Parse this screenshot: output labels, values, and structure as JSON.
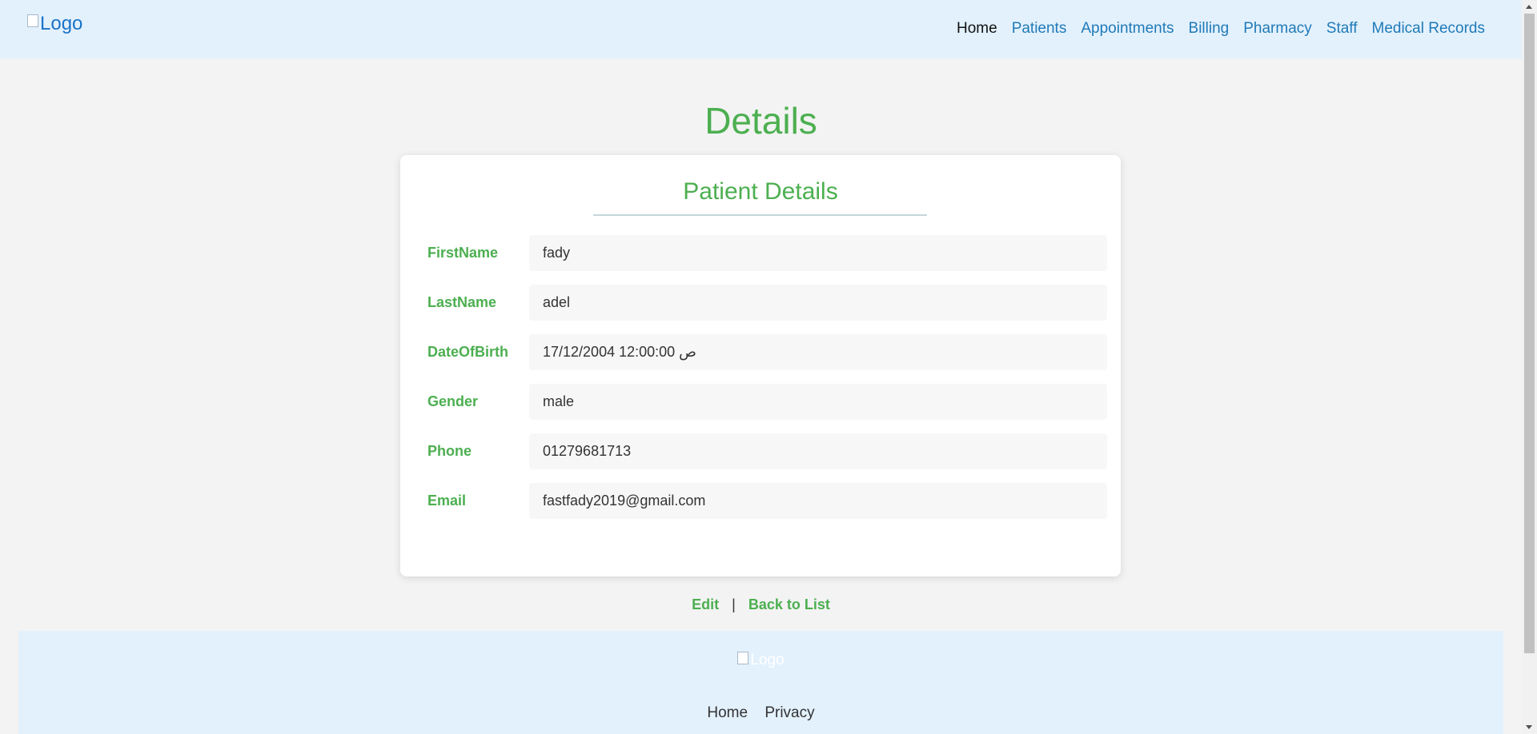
{
  "header": {
    "logo_alt": "Logo",
    "nav": {
      "home": "Home",
      "patients": "Patients",
      "appointments": "Appointments",
      "billing": "Billing",
      "pharmacy": "Pharmacy",
      "staff": "Staff",
      "medical_records": "Medical Records"
    },
    "active_nav": "Home"
  },
  "main": {
    "title": "Details",
    "card": {
      "title": "Patient Details",
      "fields": [
        {
          "label": "FirstName",
          "value": "fady"
        },
        {
          "label": "LastName",
          "value": "adel"
        },
        {
          "label": "DateOfBirth",
          "value": "17/12/2004 12:00:00 ص"
        },
        {
          "label": "Gender",
          "value": "male"
        },
        {
          "label": "Phone",
          "value": "01279681713"
        },
        {
          "label": "Email",
          "value": "fastfady2019@gmail.com"
        }
      ]
    },
    "actions": {
      "edit": "Edit",
      "separator": "|",
      "back": "Back to List"
    }
  },
  "footer": {
    "logo_alt": "Logo",
    "links": {
      "home": "Home",
      "privacy": "Privacy"
    }
  },
  "colors": {
    "accent_green": "#4caf50",
    "header_bg": "#e3f1fd",
    "link_blue": "#1f7ab8",
    "page_bg": "#f3f3f3"
  }
}
